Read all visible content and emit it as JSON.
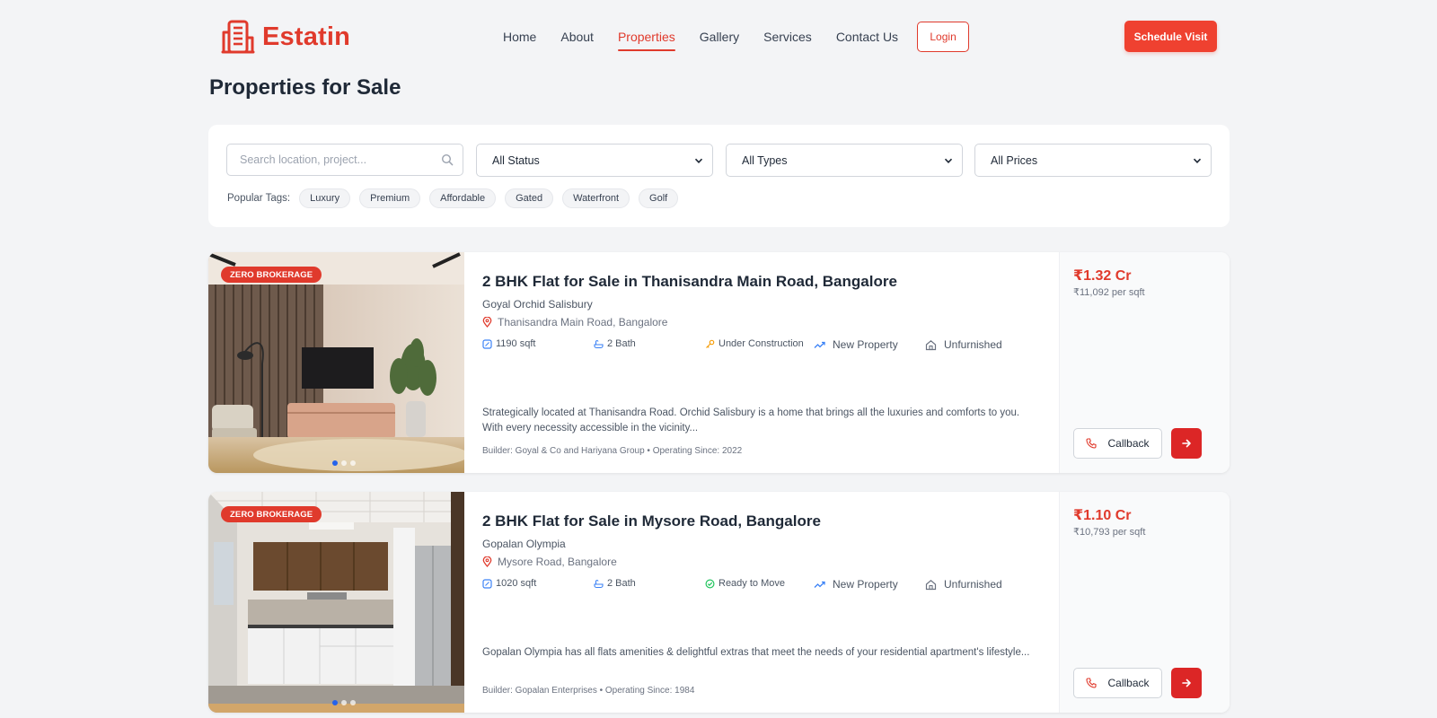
{
  "brand": {
    "name": "Estatin",
    "color": "#e03a2c",
    "icon": "building-icon"
  },
  "nav": {
    "items": [
      {
        "label": "Home",
        "active": false
      },
      {
        "label": "About",
        "active": false
      },
      {
        "label": "Properties",
        "active": true
      },
      {
        "label": "Gallery",
        "active": false
      },
      {
        "label": "Services",
        "active": false
      },
      {
        "label": "Contact Us",
        "active": false
      }
    ],
    "login_label": "Login",
    "schedule_label": "Schedule Visit"
  },
  "page": {
    "title": "Properties for Sale"
  },
  "filters": {
    "search_placeholder": "Search location, project...",
    "status": "All Status",
    "types": "All Types",
    "prices": "All Prices",
    "tags_label": "Popular Tags:",
    "tags": [
      "Luxury",
      "Premium",
      "Affordable",
      "Gated",
      "Waterfront",
      "Golf"
    ]
  },
  "listings": [
    {
      "badge": "ZERO BROKERAGE",
      "title": "2 BHK Flat for Sale in Thanisandra Main Road, Bangalore",
      "project": "Goyal Orchid Salisbury",
      "location": "Thanisandra Main Road, Bangalore",
      "area": "1190 sqft",
      "bath": "2 Bath",
      "status": "Under Construction",
      "status_icon": "key-icon",
      "tag": "New Property",
      "furnishing": "Unfurnished",
      "description": "Strategically located at Thanisandra Road. Orchid Salisbury is a home that brings all the luxuries and comforts to you. With every necessity accessible in the vicinity...",
      "builder": "Builder: Goyal & Co and Hariyana Group • Operating Since: 2022",
      "price": "₹1.32 Cr",
      "per_sqft": "₹11,092 per sqft",
      "callback_label": "Callback"
    },
    {
      "badge": "ZERO BROKERAGE",
      "title": "2 BHK Flat for Sale in Mysore Road, Bangalore",
      "project": "Gopalan Olympia",
      "location": "Mysore Road, Bangalore",
      "area": "1020 sqft",
      "bath": "2 Bath",
      "status": "Ready to Move",
      "status_icon": "check-circle-icon",
      "tag": "New Property",
      "furnishing": "Unfurnished",
      "description": "Gopalan Olympia has all flats amenities & delightful extras that meet the needs of your residential apartment's lifestyle...",
      "builder": "Builder: Gopalan Enterprises • Operating Since: 1984",
      "price": "₹1.10 Cr",
      "per_sqft": "₹10,793 per sqft",
      "callback_label": "Callback"
    }
  ]
}
